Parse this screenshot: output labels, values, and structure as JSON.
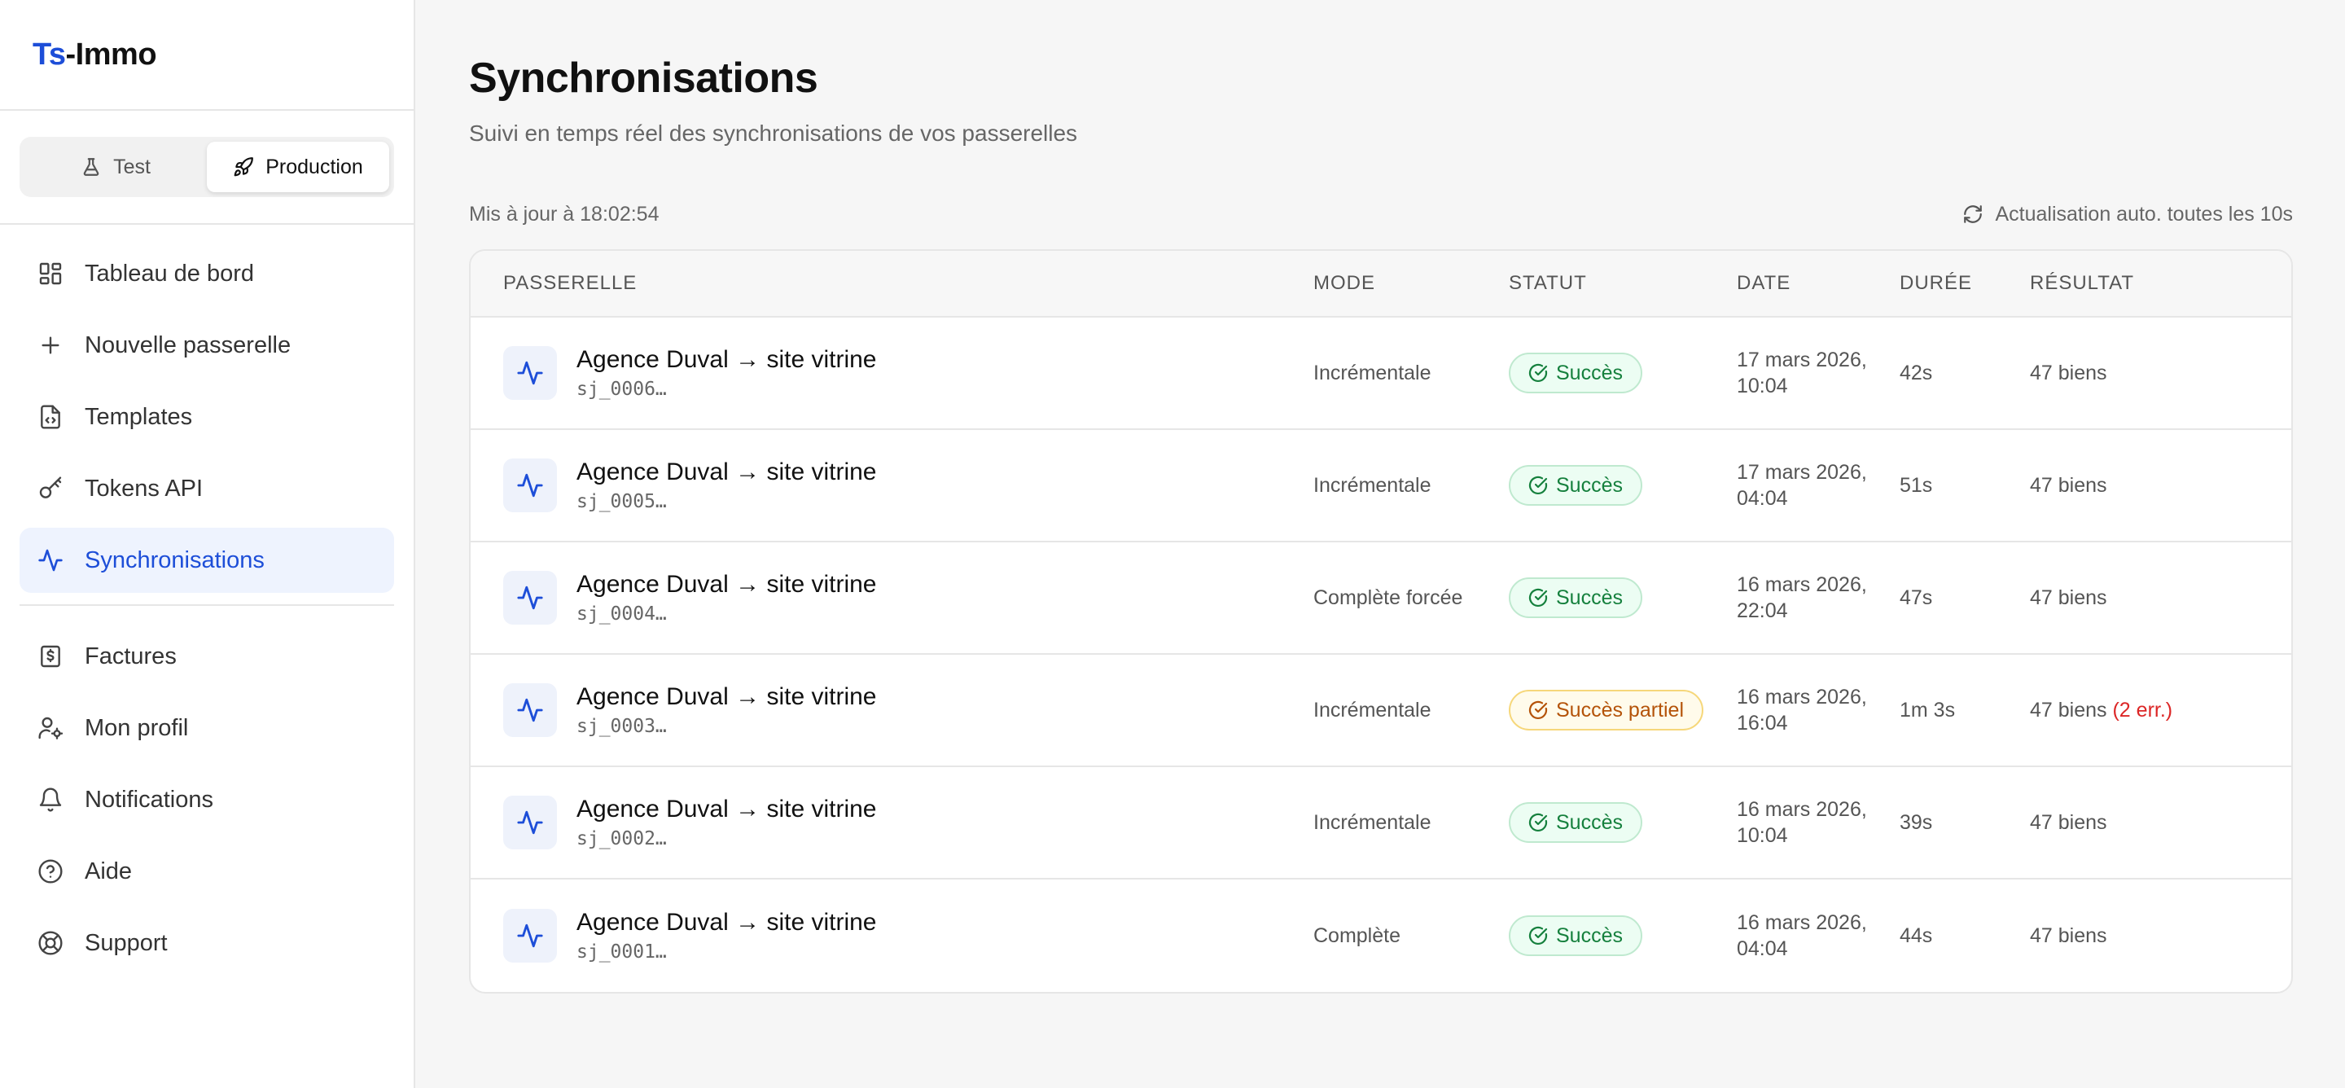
{
  "brand": {
    "prefix": "Ts",
    "suffix": "-Immo",
    "accent": "#1d4ed8"
  },
  "env": {
    "test_label": "Test",
    "prod_label": "Production",
    "active": "Production"
  },
  "nav": {
    "primary": [
      {
        "label": "Tableau de bord",
        "icon": "dashboard-icon"
      },
      {
        "label": "Nouvelle passerelle",
        "icon": "plus-icon"
      },
      {
        "label": "Templates",
        "icon": "file-code-icon"
      },
      {
        "label": "Tokens API",
        "icon": "key-icon"
      },
      {
        "label": "Synchronisations",
        "icon": "activity-icon",
        "active": true
      }
    ],
    "secondary": [
      {
        "label": "Factures",
        "icon": "receipt-icon"
      },
      {
        "label": "Mon profil",
        "icon": "user-cog-icon"
      },
      {
        "label": "Notifications",
        "icon": "bell-icon"
      },
      {
        "label": "Aide",
        "icon": "help-circle-icon"
      },
      {
        "label": "Support",
        "icon": "lifebuoy-icon"
      }
    ]
  },
  "page": {
    "title": "Synchronisations",
    "subtitle": "Suivi en temps réel des synchronisations de vos passerelles",
    "updated": "Mis à jour à 18:02:54",
    "auto_refresh": "Actualisation auto. toutes les 10s"
  },
  "table": {
    "headers": [
      "PASSERELLE",
      "MODE",
      "STATUT",
      "DATE",
      "DURÉE",
      "RÉSULTAT"
    ],
    "rows": [
      {
        "name": "Agence Duval → site vitrine",
        "code": "sj_0006…",
        "mode": "Incrémentale",
        "status": "Succès",
        "status_type": "ok",
        "date1": "17 mars 2026,",
        "date2": "10:04",
        "duration": "42s",
        "result": "47 biens",
        "errors": ""
      },
      {
        "name": "Agence Duval → site vitrine",
        "code": "sj_0005…",
        "mode": "Incrémentale",
        "status": "Succès",
        "status_type": "ok",
        "date1": "17 mars 2026,",
        "date2": "04:04",
        "duration": "51s",
        "result": "47 biens",
        "errors": ""
      },
      {
        "name": "Agence Duval → site vitrine",
        "code": "sj_0004…",
        "mode": "Complète forcée",
        "status": "Succès",
        "status_type": "ok",
        "date1": "16 mars 2026,",
        "date2": "22:04",
        "duration": "47s",
        "result": "47 biens",
        "errors": ""
      },
      {
        "name": "Agence Duval → site vitrine",
        "code": "sj_0003…",
        "mode": "Incrémentale",
        "status": "Succès partiel",
        "status_type": "partial",
        "date1": "16 mars 2026,",
        "date2": "16:04",
        "duration": "1m 3s",
        "result": "47 biens",
        "errors": "(2 err.)"
      },
      {
        "name": "Agence Duval → site vitrine",
        "code": "sj_0002…",
        "mode": "Incrémentale",
        "status": "Succès",
        "status_type": "ok",
        "date1": "16 mars 2026,",
        "date2": "10:04",
        "duration": "39s",
        "result": "47 biens",
        "errors": ""
      },
      {
        "name": "Agence Duval → site vitrine",
        "code": "sj_0001…",
        "mode": "Complète",
        "status": "Succès",
        "status_type": "ok",
        "date1": "16 mars 2026,",
        "date2": "04:04",
        "duration": "44s",
        "result": "47 biens",
        "errors": ""
      }
    ]
  }
}
